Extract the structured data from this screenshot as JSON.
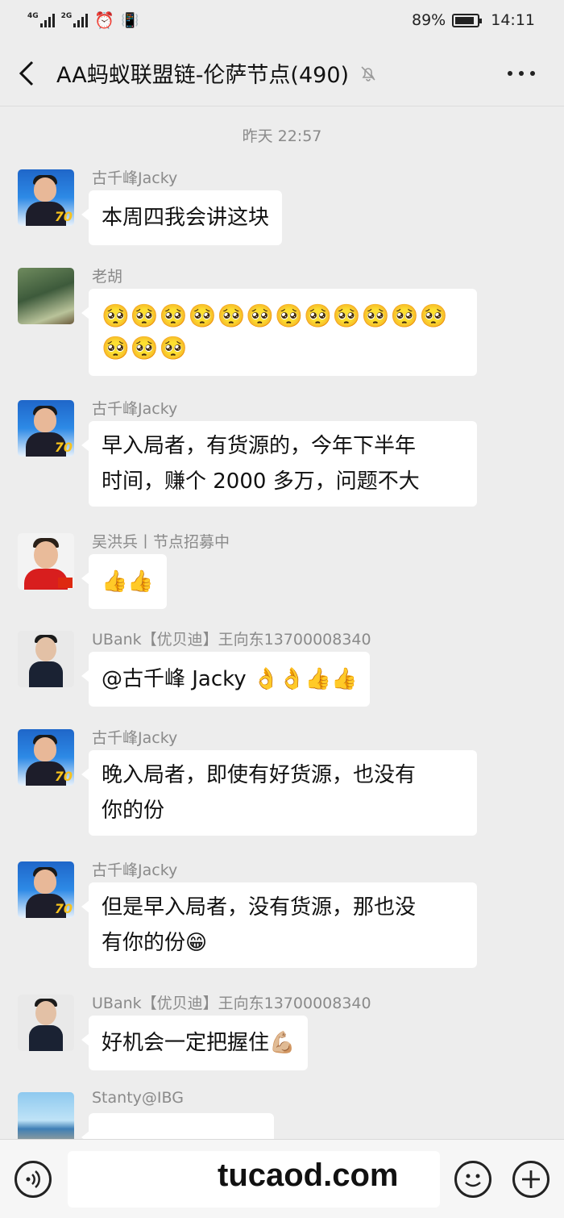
{
  "status_bar": {
    "signal1_label": "4G",
    "signal2_label": "2G",
    "battery_percent": "89%",
    "battery_level": 0.89,
    "time": "14:11"
  },
  "header": {
    "title": "AA蚂蚁联盟链-伦萨节点(490)",
    "back_icon": "chevron-left-icon",
    "mute_icon": "bell-muted-icon",
    "more_icon": "more-dots-icon"
  },
  "chat": {
    "timestamp": "昨天 22:57",
    "messages": [
      {
        "sender": "古千峰Jacky",
        "text": "本周四我会讲这块"
      },
      {
        "sender": "老胡",
        "emoji_line1": "🥺🥺🥺🥺🥺🥺🥺🥺🥺🥺🥺🥺",
        "emoji_line2": "🥺🥺🥺"
      },
      {
        "sender": "古千峰Jacky",
        "line1": "早入局者，有货源的，今年下半年",
        "line2": "时间，赚个 2000 多万，问题不大"
      },
      {
        "sender": "吴洪兵丨节点招募中",
        "text": "👍👍"
      },
      {
        "sender": "UBank【优贝迪】王向东13700008340",
        "text": "@古千峰 Jacky 👌👌👍👍"
      },
      {
        "sender": "古千峰Jacky",
        "line1": "晚入局者，即使有好货源，也没有",
        "line2": "你的份"
      },
      {
        "sender": "古千峰Jacky",
        "line1": "但是早入局者，没有货源，那也没",
        "line2": "有你的份😁"
      },
      {
        "sender": "UBank【优贝迪】王向东13700008340",
        "text": "好机会一定把握住💪🏼"
      },
      {
        "sender": "Stanty@IBG"
      }
    ]
  },
  "input_bar": {
    "voice_icon": "voice-icon",
    "emoji_icon": "smiley-icon",
    "plus_icon": "plus-icon",
    "watermark": "tucaod.com"
  }
}
